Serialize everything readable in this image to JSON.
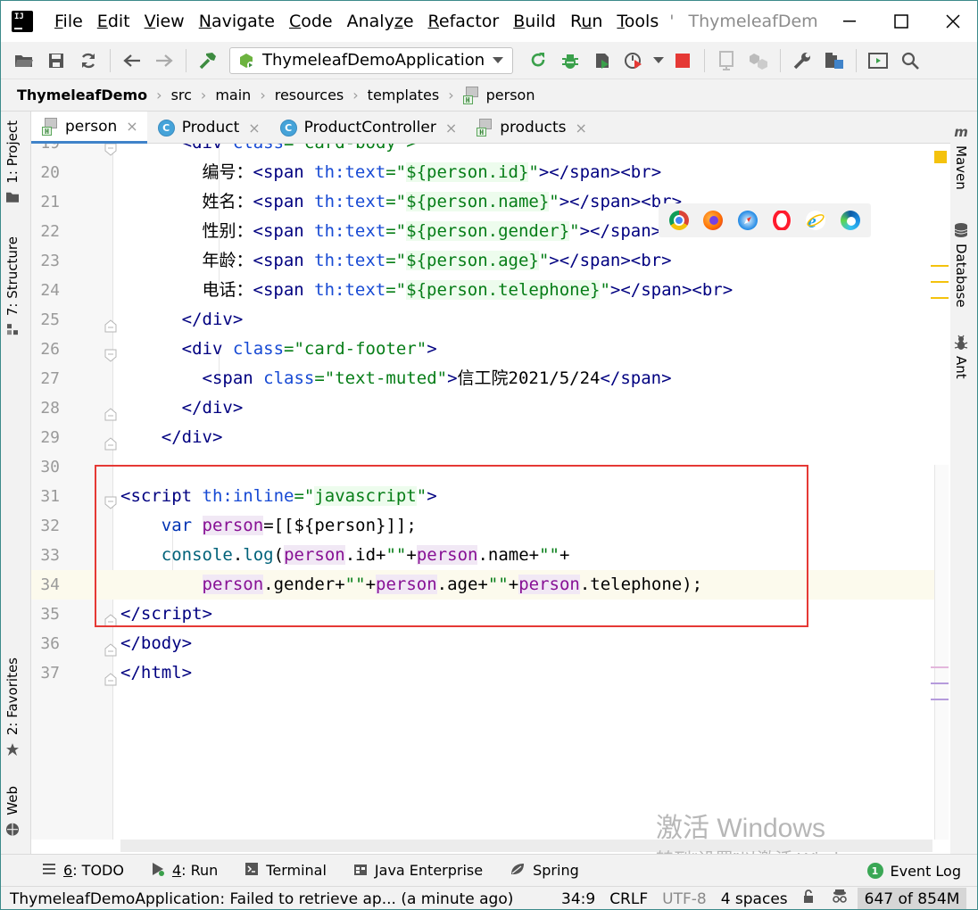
{
  "menubar": {
    "items": [
      {
        "pre": "",
        "key": "F",
        "post": "ile"
      },
      {
        "pre": "",
        "key": "E",
        "post": "dit"
      },
      {
        "pre": "",
        "key": "V",
        "post": "iew"
      },
      {
        "pre": "",
        "key": "N",
        "post": "avigate"
      },
      {
        "pre": "",
        "key": "C",
        "post": "ode"
      },
      {
        "pre": "Analy",
        "key": "z",
        "post": "e"
      },
      {
        "pre": "",
        "key": "R",
        "post": "efactor"
      },
      {
        "pre": "",
        "key": "B",
        "post": "uild"
      },
      {
        "pre": "R",
        "key": "u",
        "post": "n"
      },
      {
        "pre": "",
        "key": "T",
        "post": "ools"
      }
    ],
    "overflow": "'",
    "window_title": "ThymeleafDem"
  },
  "toolbar": {
    "run_config": "ThymeleafDemoApplication"
  },
  "breadcrumb": [
    "ThymeleafDemo",
    "src",
    "main",
    "resources",
    "templates",
    "person"
  ],
  "left_tabs": {
    "project": "1: Project",
    "structure": "7: Structure",
    "favorites": "2: Favorites",
    "web": "Web"
  },
  "right_tabs": {
    "maven": "Maven",
    "database": "Database",
    "ant": "Ant"
  },
  "editor_tabs": [
    {
      "label": "person",
      "type": "html",
      "active": true
    },
    {
      "label": "Product",
      "type": "class",
      "active": false
    },
    {
      "label": "ProductController",
      "type": "class",
      "active": false
    },
    {
      "label": "products",
      "type": "html",
      "active": false
    }
  ],
  "code": {
    "lines": [
      {
        "n": "19",
        "t19": "<div class=\"card-body\">"
      },
      {
        "n": "20",
        "label": "编号：",
        "field": "${person.id}"
      },
      {
        "n": "21",
        "label": "姓名：",
        "field": "${person.name}"
      },
      {
        "n": "22",
        "label": "性别：",
        "field": "${person.gender}"
      },
      {
        "n": "23",
        "label": "年龄：",
        "field": "${person.age}"
      },
      {
        "n": "24",
        "label": "电话：",
        "field": "${person.telephone}"
      },
      {
        "n": "25"
      },
      {
        "n": "26"
      },
      {
        "n": "27",
        "footer_text": "信工院2021/5/24"
      },
      {
        "n": "28"
      },
      {
        "n": "29"
      },
      {
        "n": "30"
      },
      {
        "n": "31"
      },
      {
        "n": "32"
      },
      {
        "n": "33"
      },
      {
        "n": "34"
      },
      {
        "n": "35"
      },
      {
        "n": "36"
      },
      {
        "n": "37"
      }
    ],
    "span_tag": "span",
    "th_text_attr": "th:text",
    "br_tag": "br",
    "div_tag": "div",
    "class_attr": "class",
    "card_footer": "card-footer",
    "text_muted": "text-muted",
    "script_tag": "script",
    "th_inline": "th:inline",
    "javascript": "javascript",
    "var_kw": "var",
    "person_var": "person",
    "inline_expr": "[[${person}]];",
    "console": "console",
    "log": "log",
    "body_tag": "body",
    "html_tag": "html"
  },
  "watermark": {
    "line1": "激活 Windows",
    "line2": "转到“设置”以激活 Windows。"
  },
  "tool_windows": [
    {
      "key": "6",
      "label": ": TODO"
    },
    {
      "key": "4",
      "label": ": Run"
    },
    {
      "key": "",
      "label": "Terminal"
    },
    {
      "key": "",
      "label": "Java Enterprise"
    },
    {
      "key": "",
      "label": "Spring"
    }
  ],
  "event_log": {
    "count": "1",
    "label": "Event Log"
  },
  "status": {
    "message": "ThymeleafDemoApplication: Failed to retrieve ap... (a minute ago)",
    "position": "34:9",
    "line_sep": "CRLF",
    "encoding": "UTF-8",
    "indent": "4 spaces",
    "memory": "647 of 854M"
  },
  "colors": {
    "accent": "#4083c9",
    "highlight_box": "#e53935",
    "tag": "#000080",
    "string": "#067d17"
  }
}
